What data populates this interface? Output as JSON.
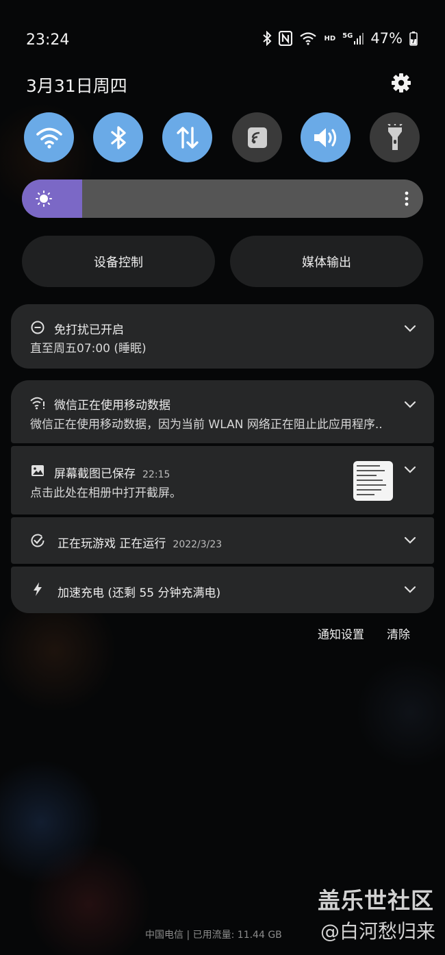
{
  "status_bar": {
    "time": "23:24",
    "hd_label": "HD",
    "net_label": "5G",
    "battery": "47%"
  },
  "header": {
    "date": "3月31日周四"
  },
  "quick_toggles": [
    {
      "name": "wifi",
      "icon": "wifi-icon",
      "state": "on"
    },
    {
      "name": "bluetooth",
      "icon": "bluetooth-icon",
      "state": "on"
    },
    {
      "name": "mobile-data",
      "icon": "mobile-data-icon",
      "state": "on"
    },
    {
      "name": "nfc",
      "icon": "nfc-icon",
      "state": "off"
    },
    {
      "name": "sound",
      "icon": "sound-icon",
      "state": "on"
    },
    {
      "name": "flashlight",
      "icon": "flashlight-icon",
      "state": "off"
    }
  ],
  "brightness": {
    "level": 0.15
  },
  "controls": {
    "device_control": "设备控制",
    "media_output": "媒体输出"
  },
  "notifications": {
    "dnd": {
      "title": "免打扰已开启",
      "subtitle": "直至周五07:00 (睡眠)"
    },
    "wechat": {
      "title": "微信正在使用移动数据",
      "subtitle": "微信正在使用移动数据，因为当前 WLAN 网络正在阻止此应用程序.."
    },
    "screenshot": {
      "title": "屏幕截图已保存",
      "time": "22:15",
      "subtitle": "点击此处在相册中打开截屏。"
    },
    "game": {
      "title": "正在玩游戏 正在运行",
      "time": "2022/3/23"
    },
    "charging": {
      "title": "加速充电 (还剩 55 分钟充满电)"
    }
  },
  "actions": {
    "settings": "通知设置",
    "clear": "清除"
  },
  "footer": {
    "carrier": "中国电信 | 已用流量: 11.44 GB",
    "watermark_title": "盖乐世社区",
    "watermark_user": "@白河愁归来"
  },
  "colors": {
    "toggle_on": "#6aaae7",
    "toggle_off": "#3a3a3a",
    "brightness_fill": "#7b68c6",
    "card": "#262728"
  }
}
